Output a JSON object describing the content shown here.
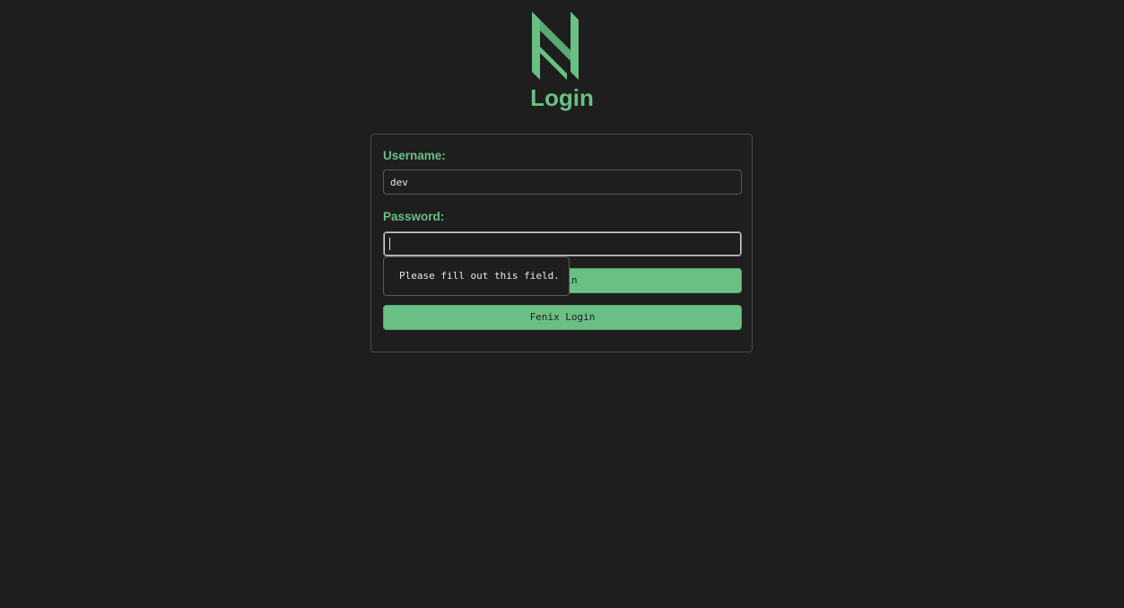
{
  "header": {
    "title": "Login",
    "logo_icon": "fenix-logo-icon"
  },
  "form": {
    "username_label": "Username:",
    "username_value": "dev",
    "password_label": "Password:",
    "password_value": "",
    "login_button_label": "Login",
    "fenix_login_button_label": "Fenix Login"
  },
  "validation": {
    "message": "Please fill out this field."
  },
  "colors": {
    "background": "#1e1e1e",
    "accent": "#6abf85",
    "border": "#4a4a4a"
  }
}
